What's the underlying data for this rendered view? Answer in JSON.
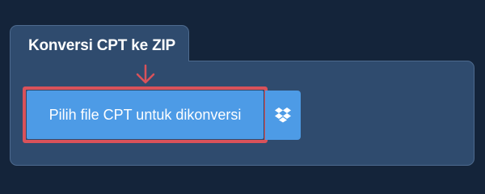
{
  "panel": {
    "title": "Konversi CPT ke ZIP"
  },
  "upload": {
    "button_label": "Pilih file CPT untuk dikonversi",
    "dropbox_icon": "dropbox-icon"
  },
  "colors": {
    "background": "#14243a",
    "panel": "#2f4b6e",
    "button": "#4d9be6",
    "highlight": "#d9525a"
  }
}
